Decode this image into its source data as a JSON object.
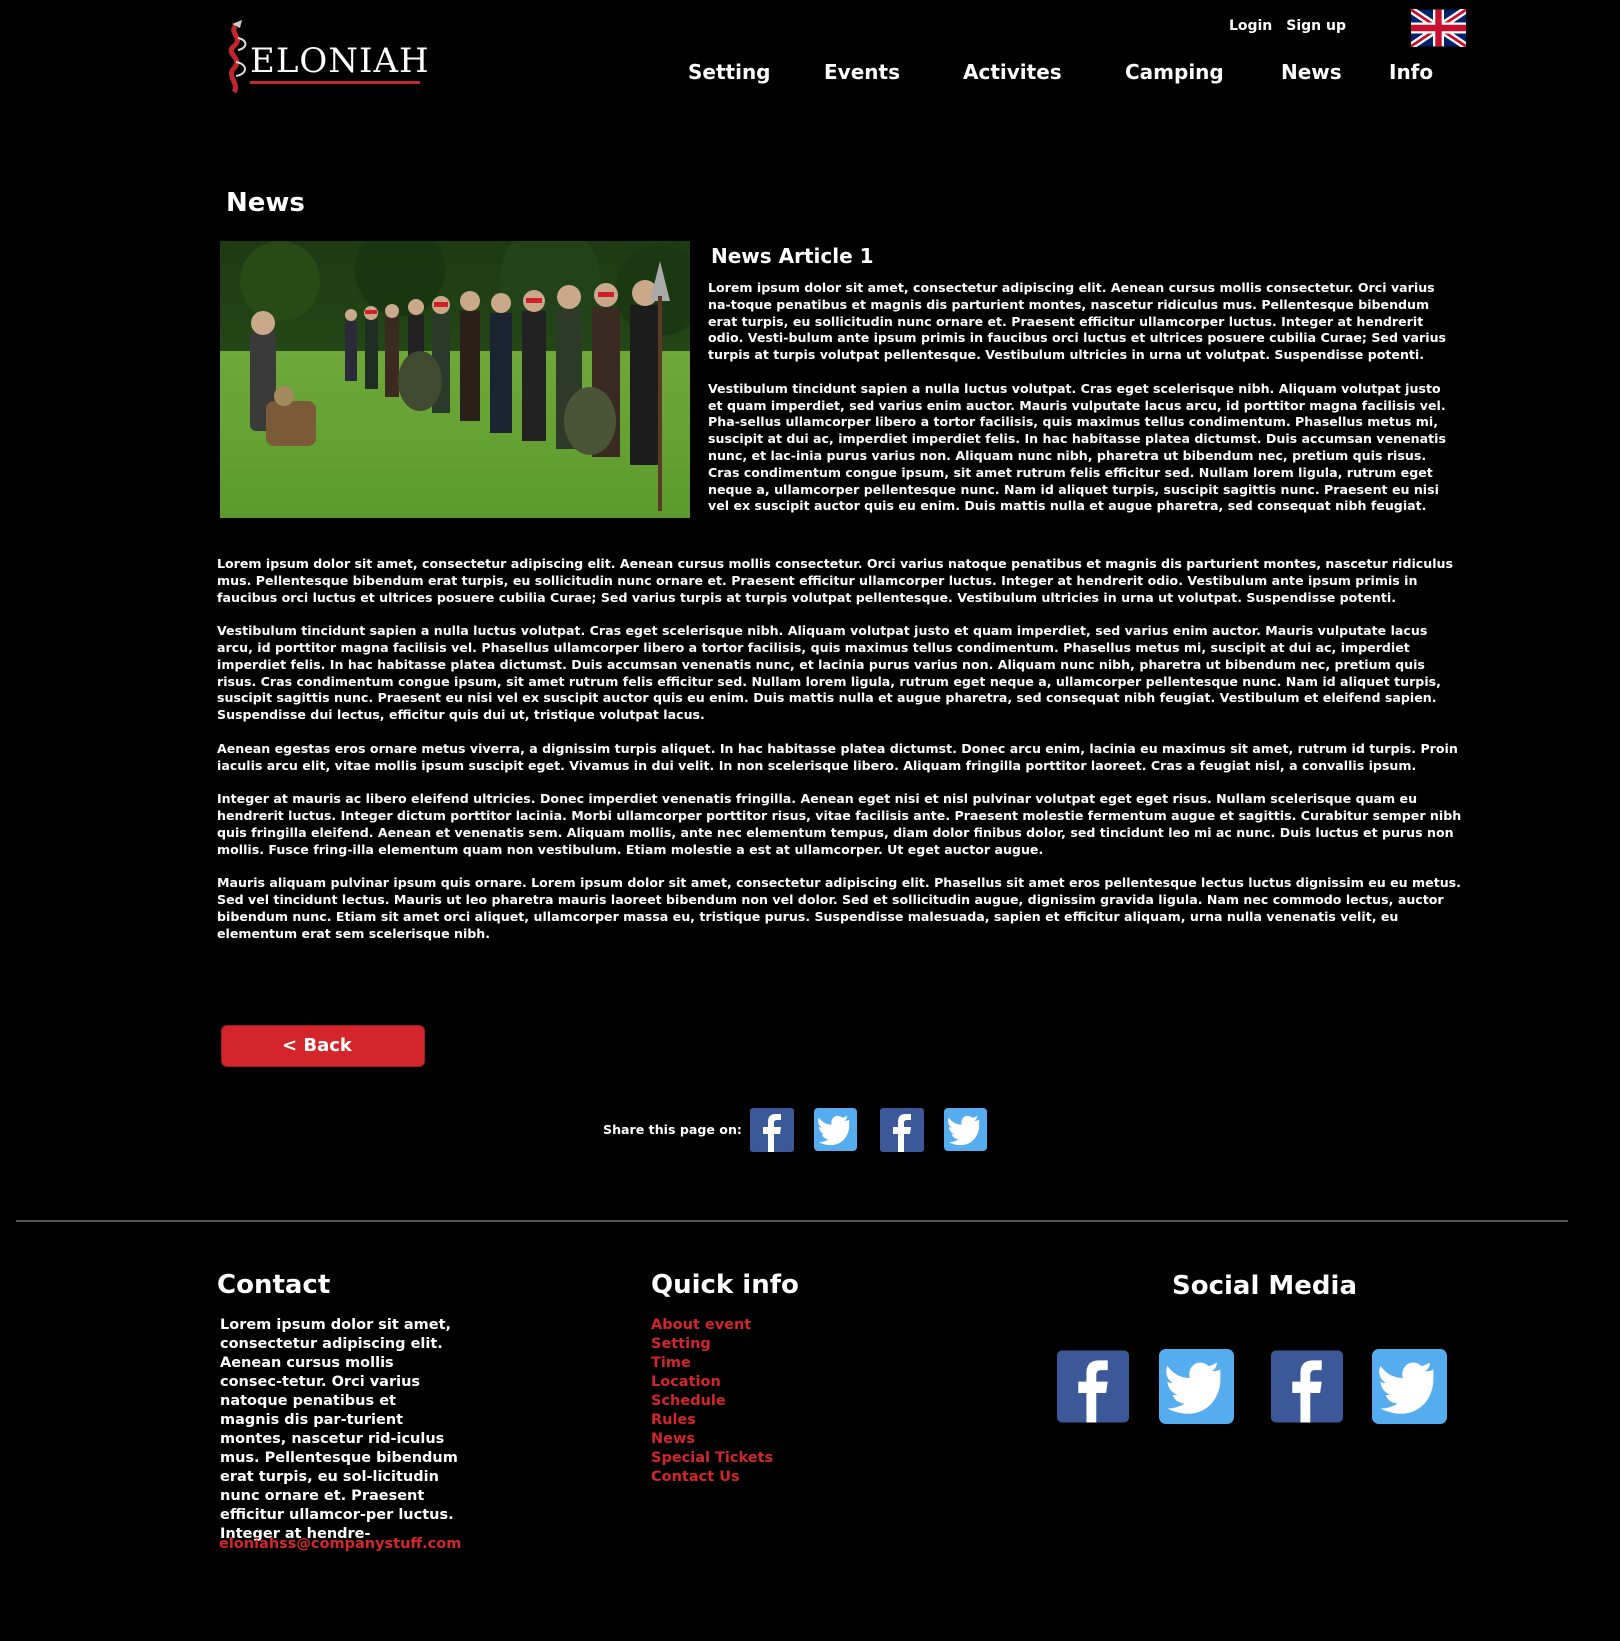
{
  "header": {
    "logo_text": "ELONIAH",
    "login": "Login",
    "signup": "Sign up",
    "language_icon": "uk-flag-icon",
    "nav": [
      "Setting",
      "Events",
      "Activites",
      "Camping",
      "News",
      "Info"
    ]
  },
  "main": {
    "page_title": "News",
    "article_title": "News Article 1",
    "intro_paragraphs": [
      "Lorem ipsum dolor sit amet, consectetur adipiscing elit. Aenean cursus mollis consectetur. Orci varius na-toque penatibus et magnis dis parturient montes, nascetur ridiculus mus. Pellentesque bibendum erat turpis, eu sollicitudin nunc ornare et. Praesent efficitur ullamcorper luctus. Integer at hendrerit odio. Vesti-bulum ante ipsum primis in faucibus orci luctus et ultrices posuere cubilia Curae; Sed varius turpis at turpis volutpat pellentesque. Vestibulum ultricies in urna ut volutpat. Suspendisse potenti.",
      "Vestibulum tincidunt sapien a nulla luctus volutpat. Cras eget scelerisque nibh. Aliquam volutpat justo et quam imperdiet, sed varius enim auctor. Mauris vulputate lacus arcu, id porttitor magna facilisis vel. Pha-sellus ullamcorper libero a tortor facilisis, quis maximus tellus condimentum. Phasellus metus mi, suscipit at dui ac, imperdiet imperdiet felis. In hac habitasse platea dictumst. Duis accumsan venenatis nunc, et lac-inia purus varius non. Aliquam nunc nibh, pharetra ut bibendum nec, pretium quis risus. Cras condimentum congue ipsum, sit amet rutrum felis efficitur sed. Nullam lorem ligula, rutrum eget neque a, ullamcorper pellentesque nunc. Nam id aliquet turpis, suscipit sagittis nunc. Praesent eu nisi vel ex suscipit auctor quis eu enim. Duis mattis nulla et augue pharetra, sed consequat nibh feugiat."
    ],
    "body_paragraphs": [
      "Lorem ipsum dolor sit amet, consectetur adipiscing elit. Aenean cursus mollis consectetur. Orci varius natoque penatibus et magnis dis parturient montes, nascetur ridiculus mus. Pellentesque bibendum erat turpis, eu sollicitudin nunc ornare et. Praesent efficitur ullamcorper luctus. Integer at hendrerit odio. Vestibulum ante ipsum primis in faucibus orci luctus et ultrices posuere cubilia Curae; Sed varius turpis at turpis volutpat pellentesque. Vestibulum ultricies in urna ut volutpat. Suspendisse potenti.",
      "Vestibulum tincidunt sapien a nulla luctus volutpat. Cras eget scelerisque nibh. Aliquam volutpat justo et quam imperdiet, sed varius enim auctor. Mauris vulputate lacus arcu, id porttitor magna facilisis vel. Phasellus ullamcorper libero a tortor facilisis, quis maximus tellus condimentum. Phasellus metus mi, suscipit at dui ac, imperdiet imperdiet felis. In hac habitasse platea dictumst. Duis accumsan venenatis nunc, et lacinia purus varius non. Aliquam nunc nibh, pharetra ut bibendum nec, pretium quis risus. Cras condimentum congue ipsum, sit amet rutrum felis efficitur sed. Nullam lorem ligula, rutrum eget neque a, ullamcorper pellentesque nunc. Nam id aliquet turpis, suscipit sagittis nunc. Praesent eu nisi vel ex suscipit auctor quis eu enim. Duis mattis nulla et augue pharetra, sed consequat nibh feugiat. Vestibulum et eleifend sapien. Suspendisse dui lectus, efficitur quis dui ut, tristique volutpat lacus.",
      "Aenean egestas eros ornare metus viverra, a dignissim turpis aliquet. In hac habitasse platea dictumst. Donec arcu enim, lacinia eu maximus sit amet, rutrum id turpis. Proin iaculis arcu elit, vitae mollis ipsum suscipit eget. Vivamus in dui velit. In non scelerisque libero. Aliquam fringilla porttitor laoreet. Cras a feugiat nisl, a convallis ipsum.",
      "Integer at mauris ac libero eleifend ultricies. Donec imperdiet venenatis fringilla. Aenean eget nisi et nisl pulvinar volutpat eget eget risus. Nullam scelerisque quam eu hendrerit luctus. Integer dictum porttitor lacinia. Morbi ullamcorper porttitor risus, vitae facilisis ante. Praesent molestie fermentum augue et sagittis. Curabitur semper nibh quis fringilla eleifend. Aenean et venenatis sem. Aliquam mollis, ante nec elementum tempus, diam dolor finibus dolor, sed tincidunt leo mi ac nunc. Duis luctus et purus non mollis. Fusce fring-illa elementum quam non vestibulum. Etiam molestie a est at ullamcorper. Ut eget auctor augue.",
      "Mauris aliquam pulvinar ipsum quis ornare. Lorem ipsum dolor sit amet, consectetur adipiscing elit. Phasellus sit amet eros pellentesque lectus luctus dignissim eu eu metus. Sed vel tincidunt lectus. Mauris ut leo pharetra mauris laoreet bibendum non vel dolor. Sed et sollicitudin augue, dignissim gravida ligula. Nam nec commodo lectus, auctor bibendum nunc. Etiam sit amet orci aliquet, ullamcorper massa eu, tristique purus. Suspendisse malesuada, sapien et efficitur aliquam, urna nulla venenatis velit, eu elementum erat sem scelerisque nibh."
    ],
    "back_label": "< Back",
    "share_label": "Share this page on:",
    "share_icons": [
      "facebook-icon",
      "twitter-icon",
      "facebook-icon",
      "twitter-icon"
    ]
  },
  "footer": {
    "contact_title": "Contact",
    "contact_text": "Lorem ipsum dolor sit amet, consectetur adipiscing elit. Aenean cursus mollis consec-tetur. Orci varius natoque penatibus et magnis dis par-turient montes, nascetur rid-iculus mus. Pellentesque bibendum erat turpis, eu sol-licitudin nunc ornare et. Praesent efficitur ullamcor-per luctus. Integer at hendre-",
    "email": "eloniahss@companystuff.com",
    "quick_title": "Quick info",
    "quick_links": [
      "About event",
      "Setting",
      "Time",
      "Location",
      "Schedule",
      "Rules",
      "News",
      "Special Tickets",
      "Contact Us"
    ],
    "social_title": "Social Media",
    "social_icons": [
      "facebook-icon",
      "twitter-icon",
      "facebook-icon",
      "twitter-icon"
    ]
  },
  "colors": {
    "background": "#000000",
    "accent_red": "#d4262a",
    "facebook_blue": "#3b5998",
    "twitter_blue": "#55acee",
    "divider": "#555555"
  }
}
